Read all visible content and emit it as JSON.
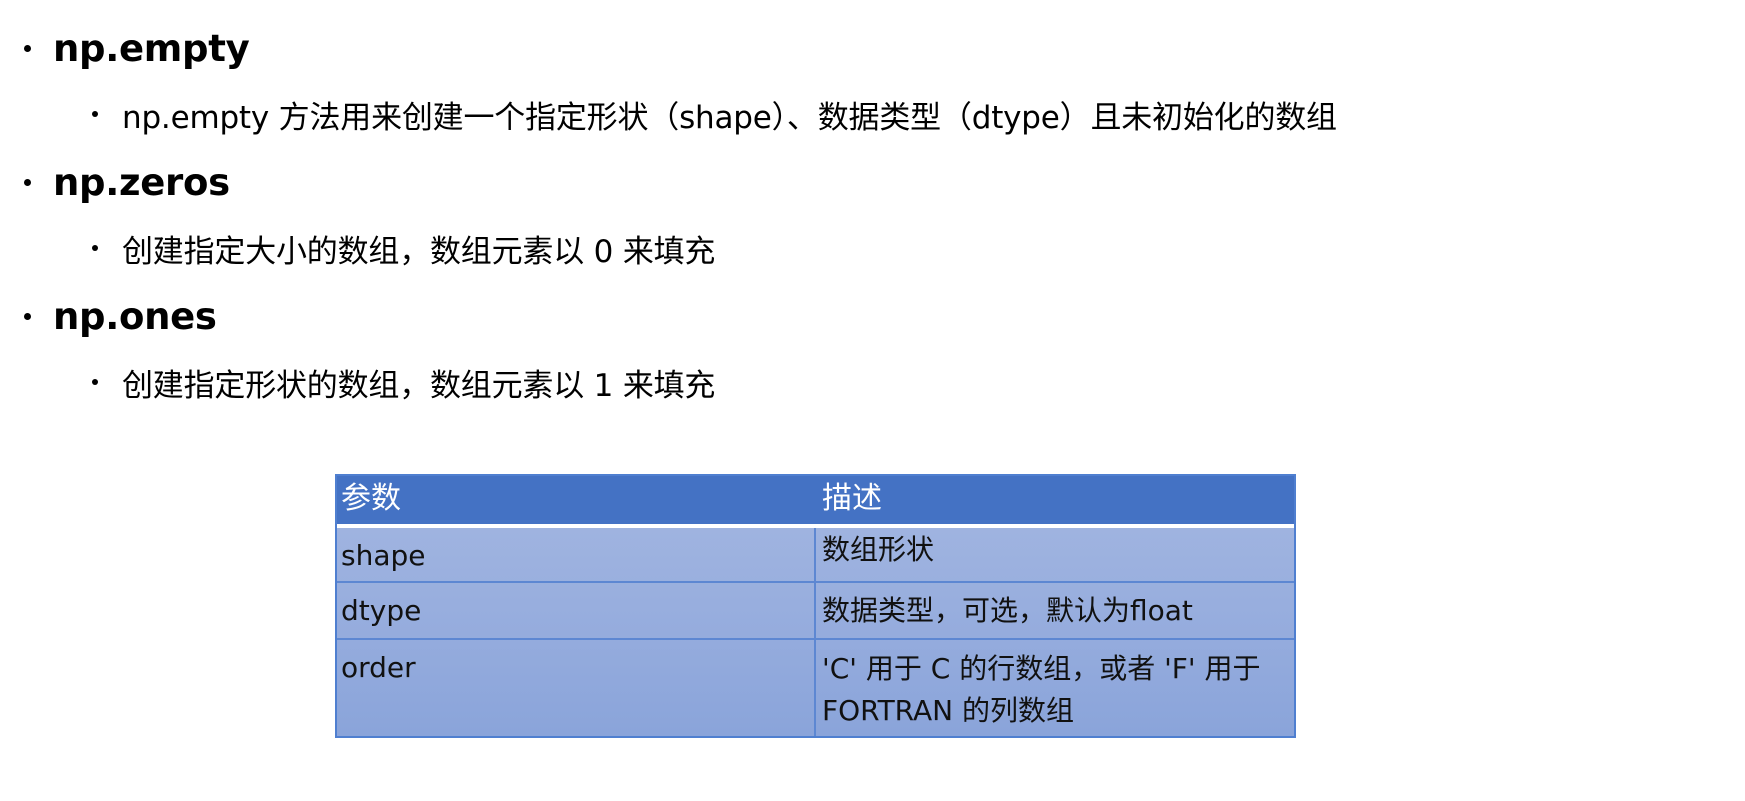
{
  "bullets": [
    {
      "title": "np.empty",
      "description": "np.empty 方法用来创建一个指定形状（shape）、数据类型（dtype）且未初始化的数组"
    },
    {
      "title": "np.zeros",
      "description": "创建指定大小的数组，数组元素以 0 来填充"
    },
    {
      "title": "np.ones",
      "description": "创建指定形状的数组，数组元素以 1 来填充"
    }
  ],
  "table": {
    "headers": [
      "参数",
      "描述"
    ],
    "rows": [
      {
        "param": "shape",
        "desc": "数组形状"
      },
      {
        "param": "dtype",
        "desc": "数据类型，可选，默认为float"
      },
      {
        "param": "order",
        "desc": "'C' 用于 C 的行数组，或者 'F' 用于 FORTRAN 的列数组"
      }
    ]
  },
  "colors": {
    "header_bg": "#4472c4",
    "row_bg": "#9fb3df",
    "border": "#5d87d2"
  }
}
